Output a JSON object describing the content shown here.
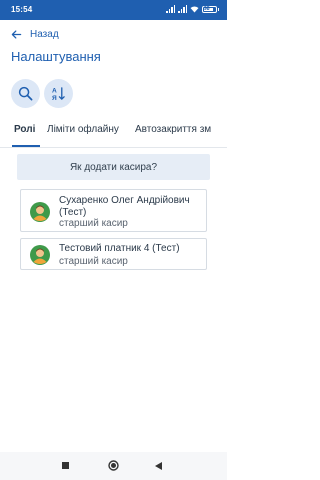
{
  "status_bar": {
    "time": "15:54",
    "battery": "98"
  },
  "header": {
    "back_label": "Назад",
    "title": "Налаштування"
  },
  "actions": {
    "search_icon": "search-icon",
    "sort_icon": "sort-alpha-icon"
  },
  "tabs": [
    {
      "label": "Ролі",
      "active": true
    },
    {
      "label": "Ліміти офлайну",
      "active": false
    },
    {
      "label": "Автозакриття зм",
      "active": false
    }
  ],
  "howto_button": "Як додати касира?",
  "cashiers": [
    {
      "name": "Сухаренко Олег Андрійович (Тест)",
      "role": "старший касир",
      "avatar_color": "#3f9a4a"
    },
    {
      "name": "Тестовий платник 4 (Тест)",
      "role": "старший касир",
      "avatar_color": "#3f9a4a"
    }
  ],
  "colors": {
    "primary": "#1f5fb0",
    "chip_bg": "#dce7f6",
    "howto_bg": "#e6edf6"
  }
}
